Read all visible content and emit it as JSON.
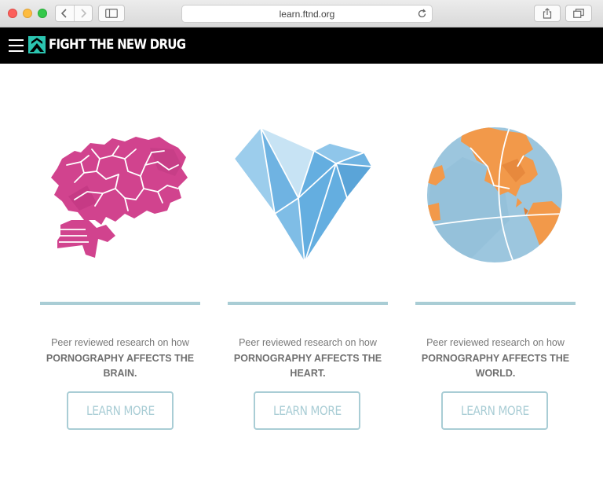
{
  "browser": {
    "url": "learn.ftnd.org"
  },
  "header": {
    "logo_text": "FIGHT THE NEW DRUG",
    "menu_icon": "hamburger-icon",
    "logo_icon": "ftnd-logo-icon"
  },
  "colors": {
    "accent": "#a9cdd5",
    "header_bg": "#000000",
    "brain": "#d1438e",
    "heart": "#6fb3e2",
    "globe_ocean": "#9cc6de",
    "globe_land": "#f2994a",
    "logo_teal": "#2bc4b0"
  },
  "cards": [
    {
      "illustration": "brain-illustration",
      "lead": "Peer reviewed research on how",
      "topic_line1": "PORNOGRAPHY AFFECTS THE",
      "topic_line2": "BRAIN.",
      "button_label": "LEARN MORE"
    },
    {
      "illustration": "heart-illustration",
      "lead": "Peer reviewed research on how",
      "topic_line1": "PORNOGRAPHY AFFECTS THE",
      "topic_line2": "HEART.",
      "button_label": "LEARN MORE"
    },
    {
      "illustration": "globe-illustration",
      "lead": "Peer reviewed research on how",
      "topic_line1": "PORNOGRAPHY AFFECTS THE",
      "topic_line2": "WORLD.",
      "button_label": "LEARN MORE"
    }
  ]
}
